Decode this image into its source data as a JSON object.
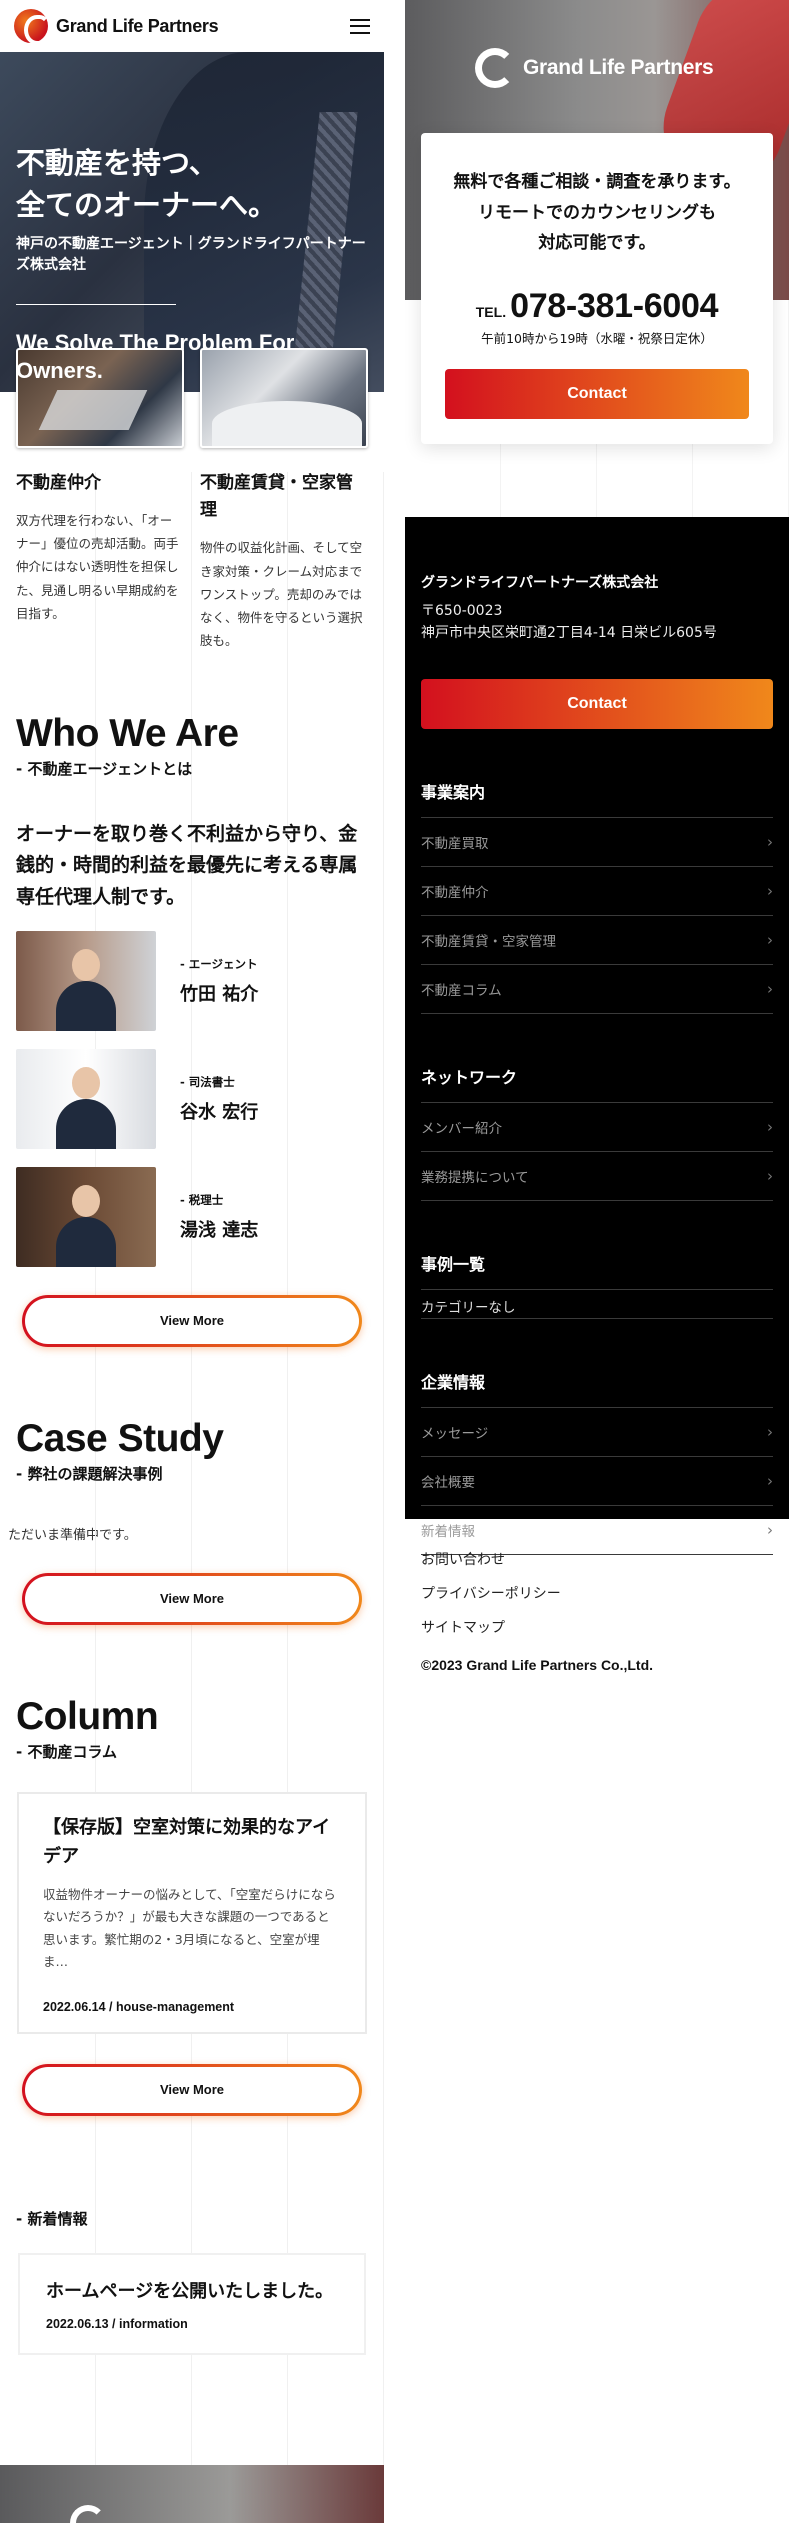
{
  "brand": {
    "name": "Grand Life Partners"
  },
  "hero": {
    "title": "不動産を持つ、\n全てのオーナーへ。",
    "subtitle": "神戸の不動産エージェント｜グランドライフパートナーズ株式会社",
    "en": "We Solve The Problem For Owners."
  },
  "services": [
    {
      "title": "不動産仲介",
      "desc": "双方代理を行わない、「オーナー」優位の売却活動。両手仲介にはない透明性を担保した、見通し明るい早期成約を目指す。"
    },
    {
      "title": "不動産賃貸・空家管理",
      "desc": "物件の収益化計画、そして空き家対策・クレーム対応までワンストップ。売却のみではなく、物件を守るという選択肢も。"
    }
  ],
  "who": {
    "heading": "Who We Are",
    "sub": "-  不動産エージェントとは",
    "lead": "オーナーを取り巻く不利益から守り、金銭的・時間的利益を最優先に考える専属専任代理人制です。",
    "members": [
      {
        "role": "- エージェント",
        "name": "竹田 祐介"
      },
      {
        "role": "- 司法書士",
        "name": "谷水 宏行"
      },
      {
        "role": "- 税理士",
        "name": "湯浅 達志"
      }
    ],
    "more": "View More"
  },
  "case": {
    "heading": "Case Study",
    "sub": "-  弊社の課題解決事例",
    "empty": "ただいま準備中です。",
    "more": "View More"
  },
  "column": {
    "heading": "Column",
    "sub": "-  不動産コラム",
    "card": {
      "title": "【保存版】空室対策に効果的なアイデア",
      "excerpt": "収益物件オーナーの悩みとして、「空室だらけにならないだろうか？」が最も大きな課題の一つであると思います。繁忙期の2・3月頃になると、空室が埋ま…",
      "meta": "2022.06.14  /  house-management"
    },
    "more": "View More"
  },
  "news": {
    "heading": "-  新着情報",
    "card": {
      "title": "ホームページを公開いたしました。",
      "meta": "2022.06.13  /  information"
    }
  },
  "consult": {
    "lines": "無料で各種ご相談・調査を承ります。\nリモートでのカウンセリングも\n対応可能です。",
    "tel_label": "TEL.",
    "tel": "078-381-6004",
    "hours": "午前10時から19時（水曜・祝祭日定休）",
    "contact": "Contact"
  },
  "footer": {
    "company": "グランドライフパートナーズ株式会社",
    "address": "〒650-0023\n神戸市中央区栄町通2丁目4-14 日栄ビル605号",
    "contact": "Contact",
    "groups": [
      {
        "head": "事業案内",
        "items": [
          "不動産買取",
          "不動産仲介",
          "不動産賃貸・空家管理",
          "不動産コラム"
        ]
      },
      {
        "head": "ネットワーク",
        "items": [
          "メンバー紹介",
          "業務提携について"
        ]
      },
      {
        "head": "事例一覧",
        "empty": "カテゴリーなし"
      },
      {
        "head": "企業情報",
        "items": [
          "メッセージ",
          "会社概要",
          "新着情報"
        ]
      }
    ],
    "links": [
      "お問い合わせ",
      "プライバシーポリシー",
      "サイトマップ"
    ],
    "copyright": "©2023 Grand Life Partners Co.,Ltd.",
    "chevron": "›"
  }
}
